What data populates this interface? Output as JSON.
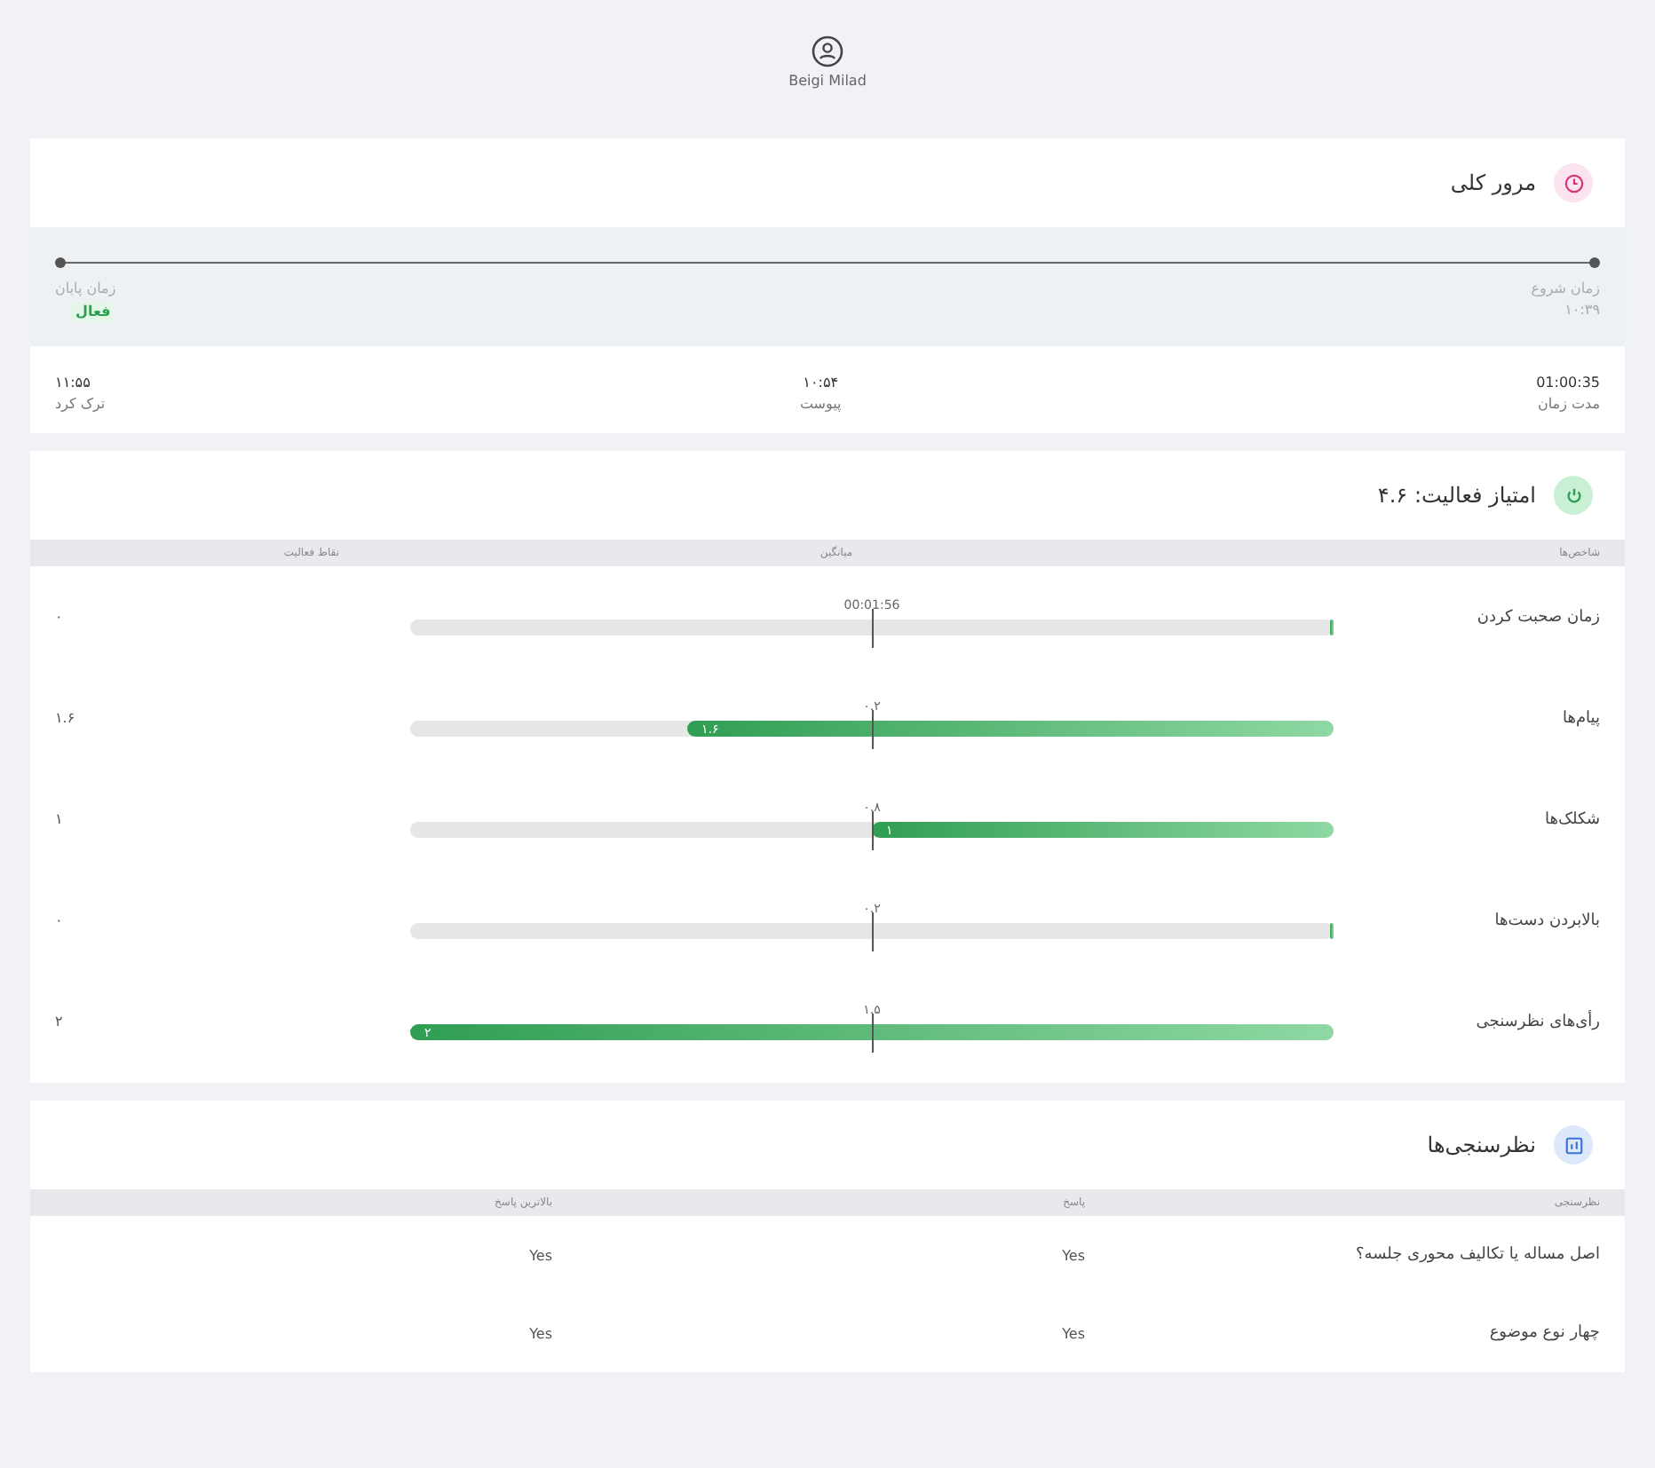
{
  "user": {
    "name": "Beigi Milad"
  },
  "overview": {
    "title": "مرور کلی",
    "start": {
      "label": "زمان شروع",
      "value": "۱۰:۳۹"
    },
    "end": {
      "label": "زمان پایان",
      "badge": "فعال"
    },
    "stats": [
      {
        "value": "01:00:35",
        "label": "مدت زمان"
      },
      {
        "value": "۱۰:۵۴",
        "label": "پیوست"
      },
      {
        "value": "۱۱:۵۵",
        "label": "ترک کرد"
      }
    ]
  },
  "activity": {
    "title": "امتیاز فعالیت: ۴.۶",
    "columns": [
      "شاخص‌ها",
      "میانگین",
      "نقاط فعالیت"
    ],
    "rows": [
      {
        "name": "زمان صحبت کردن",
        "average": "00:01:56",
        "score": "۰",
        "level": 0
      },
      {
        "name": "پیام‌ها",
        "average": "۰.۲",
        "score": "۱.۶",
        "level": 0.7,
        "fill_label": "۱.۶"
      },
      {
        "name": "شکلک‌ها",
        "average": "۰.۸",
        "score": "۱",
        "level": 0.5,
        "fill_label": "۱"
      },
      {
        "name": "بالابردن دست‌ها",
        "average": "۰.۲",
        "score": "۰",
        "level": 0
      },
      {
        "name": "رأی‌های نظرسنجی",
        "average": "۱.۵",
        "score": "۲",
        "level": 1,
        "fill_label": "۲"
      }
    ]
  },
  "polls": {
    "title": "نظرسنجی‌ها",
    "columns": [
      "نظرسنجی",
      "پاسخ",
      "بالاترین پاسخ"
    ],
    "rows": [
      {
        "question": "اصل مساله یا تکالیف محوری جلسه؟",
        "answer": "Yes",
        "top_answer": "Yes"
      },
      {
        "question": "چهار نوع موضوع",
        "answer": "Yes",
        "top_answer": "Yes"
      }
    ]
  }
}
